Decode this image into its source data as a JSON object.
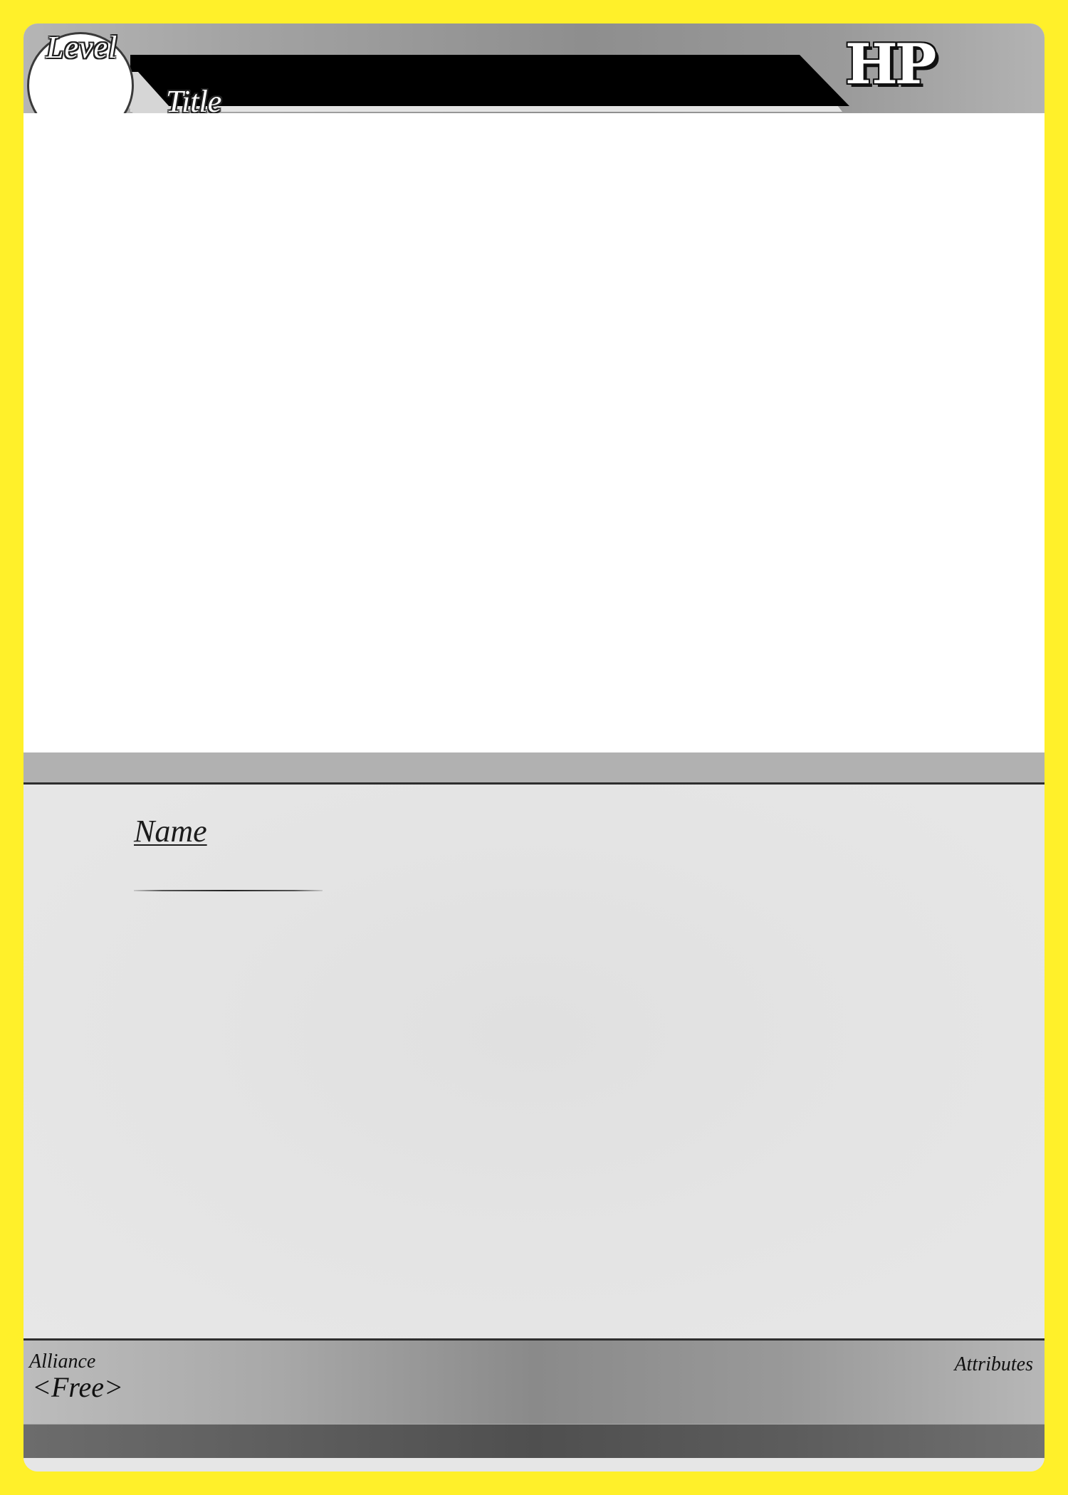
{
  "card": {
    "border_color": "#fff02a",
    "header": {
      "level_label": "Level",
      "title_label": "Title",
      "hp_label": "HP"
    },
    "name_label": "Name",
    "footer": {
      "alliance_label": "Alliance",
      "alliance_value": "<Free>",
      "attributes_label": "Attributes"
    }
  }
}
